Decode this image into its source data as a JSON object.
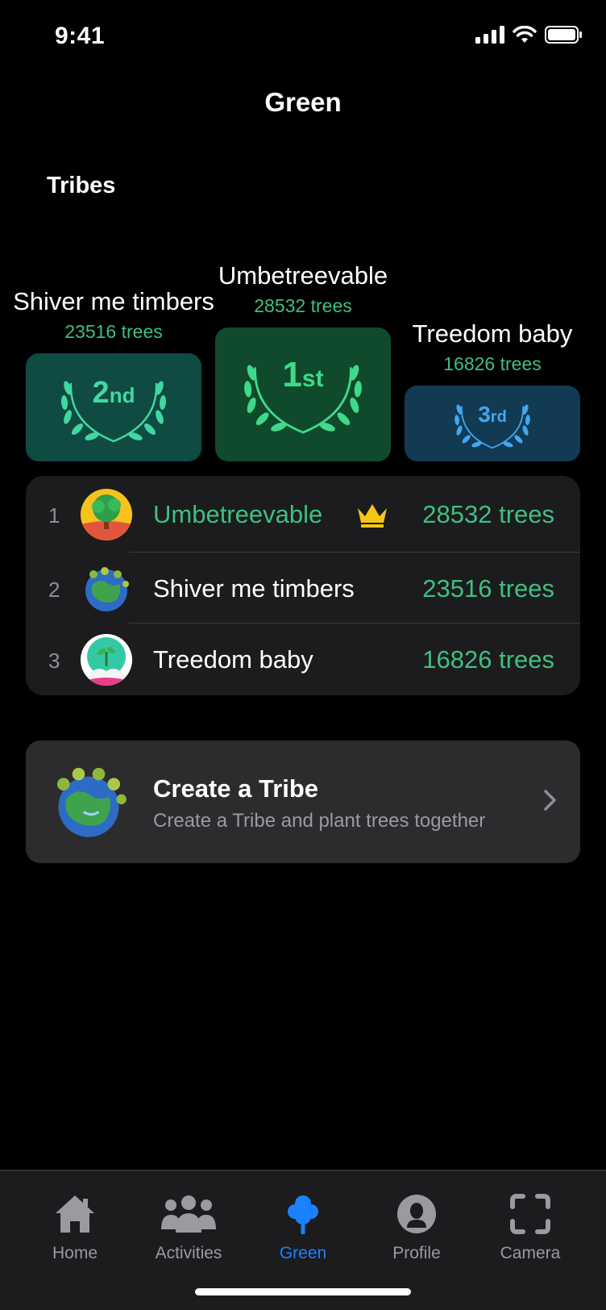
{
  "status": {
    "time": "9:41"
  },
  "nav": {
    "title": "Green"
  },
  "section": {
    "title": "Tribes"
  },
  "podium": {
    "first": {
      "name": "Umbetreevable",
      "count": "28532 trees",
      "place_num": "1",
      "place_suffix": "st"
    },
    "second": {
      "name": "Shiver me timbers",
      "count": "23516 trees",
      "place_num": "2",
      "place_suffix": "nd"
    },
    "third": {
      "name": "Treedom baby",
      "count": "16826 trees",
      "place_num": "3",
      "place_suffix": "rd"
    }
  },
  "ranking": [
    {
      "rank": "1",
      "name": "Umbetreevable",
      "trees": "28532 trees",
      "icon": "crown-icon"
    },
    {
      "rank": "2",
      "name": "Shiver me timbers",
      "trees": "23516 trees"
    },
    {
      "rank": "3",
      "name": "Treedom baby",
      "trees": "16826 trees"
    }
  ],
  "create": {
    "title": "Create a Tribe",
    "subtitle": "Create a Tribe and plant trees together"
  },
  "tabs": [
    {
      "label": "Home",
      "icon": "home-icon"
    },
    {
      "label": "Activities",
      "icon": "people-icon"
    },
    {
      "label": "Green",
      "icon": "tree-icon",
      "active": true
    },
    {
      "label": "Profile",
      "icon": "profile-icon"
    },
    {
      "label": "Camera",
      "icon": "camera-frame-icon"
    }
  ],
  "colors": {
    "accent_green": "#3fbf82",
    "active_blue": "#1a82ff",
    "gold": "#f5c518"
  }
}
